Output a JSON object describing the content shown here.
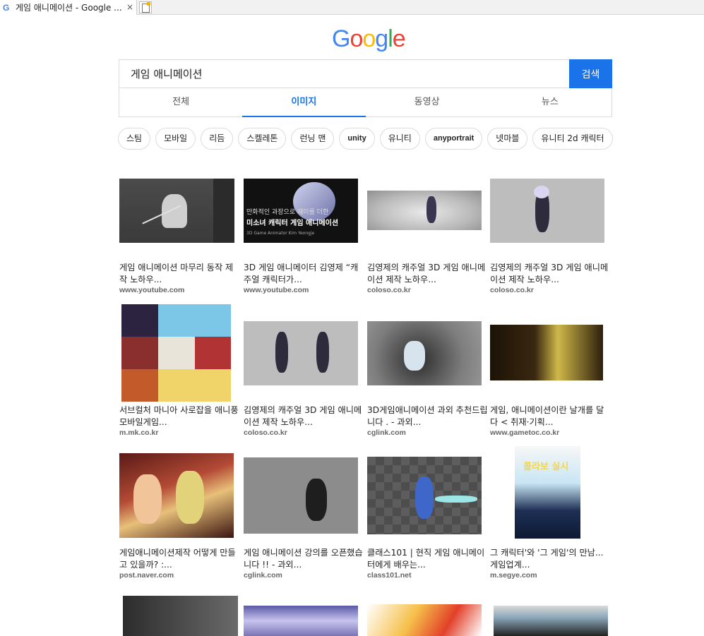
{
  "browser": {
    "tab_title": "게임 애니메이션 - Google ...",
    "tab_close": "×"
  },
  "logo": {
    "letters": [
      "G",
      "o",
      "o",
      "g",
      "l",
      "e"
    ],
    "colors": [
      "#4285F4",
      "#EA4335",
      "#FBBC05",
      "#4285F4",
      "#34A853",
      "#EA4335"
    ]
  },
  "search": {
    "query": "게임 애니메이션",
    "button_label": "검색"
  },
  "tabs": [
    {
      "label": "전체",
      "active": false
    },
    {
      "label": "이미지",
      "active": true
    },
    {
      "label": "동영상",
      "active": false
    },
    {
      "label": "뉴스",
      "active": false
    }
  ],
  "chips": [
    "스팀",
    "모바일",
    "리듬",
    "스켈레톤",
    "런닝 맨",
    "unity",
    "유니티",
    "anyportrait",
    "넷마블",
    "유니티 2d 캐릭터"
  ],
  "thumb_text": {
    "r2_line1": "만화적인 과장으로 재미를 더한",
    "r2_line2": "미소녀 캐릭터 게임 애니메이션",
    "r2_line3": "3D Game Animator Kim Yeongje",
    "r11_banner": "콜라보 실시"
  },
  "results": [
    {
      "title": "게임 애니메이션 마무리 동작 제작 노하우...",
      "source": "www.youtube.com"
    },
    {
      "title": "3D 게임 애니메이터 김영제 “캐주얼 캐릭터가...",
      "source": "www.youtube.com"
    },
    {
      "title": "김영제의 캐주얼 3D 게임 애니메이션 제작 노하우...",
      "source": "coloso.co.kr"
    },
    {
      "title": "김영제의 캐주얼 3D 게임 애니메이션 제작 노하우...",
      "source": "coloso.co.kr"
    },
    {
      "title": "서브컬처 마니아 사로잡을 애니풍 모바일게임...",
      "source": "m.mk.co.kr"
    },
    {
      "title": "김영제의 캐주얼 3D 게임 애니메이션 제작 노하우...",
      "source": "coloso.co.kr"
    },
    {
      "title": "3D게임애니메이션 과외 추천드립니다 . - 과외...",
      "source": "cglink.com"
    },
    {
      "title": "게임, 애니메이션이란 날개를 달다 < 취재·기획...",
      "source": "www.gametoc.co.kr"
    },
    {
      "title": "게임애니메이션제작 어떻게 만들고 있을까? :...",
      "source": "post.naver.com"
    },
    {
      "title": "게임 애니메이션 강의를 오픈했습니다 !! - 과외...",
      "source": "cglink.com"
    },
    {
      "title": "클래스101 | 현직 게임 애니메이터에게 배우는...",
      "source": "class101.net"
    },
    {
      "title": "그 캐릭터'와 '그 게임'의 만남... 게임업계...",
      "source": "m.segye.com"
    }
  ]
}
